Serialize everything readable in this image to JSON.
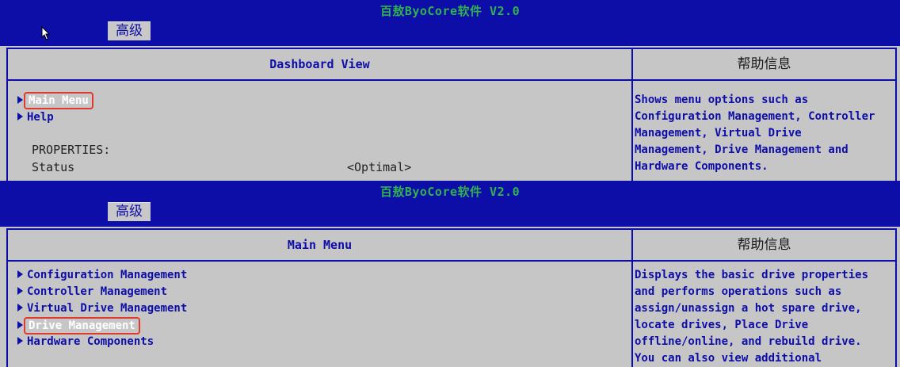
{
  "screens": [
    {
      "title": "百敖ByoCore软件 V2.0",
      "tab": "高级",
      "main_header": "Dashboard View",
      "help_header": "帮助信息",
      "menu_items": [
        "Main Menu",
        "Help"
      ],
      "selected_item": "Main Menu",
      "properties_label": "PROPERTIES:",
      "properties": [
        {
          "label": "Status",
          "value": "<Optimal>"
        }
      ],
      "help_text": "Shows menu options such as\nConfiguration Management, Controller\nManagement, Virtual Drive\nManagement, Drive Management and\nHardware Components."
    },
    {
      "title": "百敖ByoCore软件 V2.0",
      "tab": "高级",
      "main_header": "Main Menu",
      "help_header": "帮助信息",
      "menu_items": [
        "Configuration Management",
        "Controller Management",
        "Virtual Drive Management",
        "Drive Management",
        "Hardware Components"
      ],
      "selected_item": "Drive Management",
      "help_text": "Displays the basic drive properties\nand performs operations such as\nassign/unassign a hot spare drive,\nlocate drives, Place Drive\noffline/online, and rebuild drive.\nYou can also view additional"
    }
  ],
  "colors": {
    "title_bar": "#0d0da8",
    "body_bg": "#c6c6c6",
    "title_text": "#2fb24f",
    "highlight_box": "#e03a2e"
  },
  "icons": [
    "mouse-cursor-icon",
    "arrow-right-icon"
  ]
}
